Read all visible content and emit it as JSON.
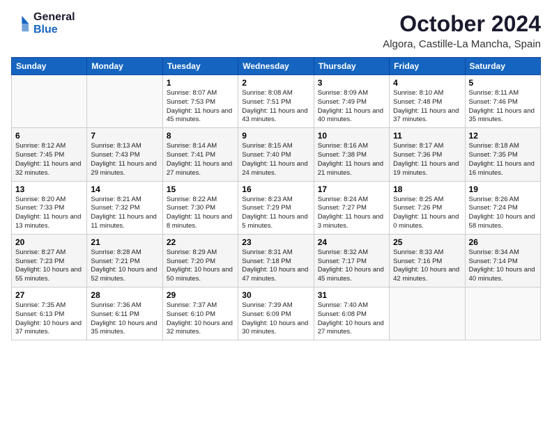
{
  "logo": {
    "general": "General",
    "blue": "Blue"
  },
  "title": "October 2024",
  "subtitle": "Algora, Castille-La Mancha, Spain",
  "days_header": [
    "Sunday",
    "Monday",
    "Tuesday",
    "Wednesday",
    "Thursday",
    "Friday",
    "Saturday"
  ],
  "weeks": [
    [
      {
        "day": "",
        "sunrise": "",
        "sunset": "",
        "daylight": ""
      },
      {
        "day": "",
        "sunrise": "",
        "sunset": "",
        "daylight": ""
      },
      {
        "day": "1",
        "sunrise": "Sunrise: 8:07 AM",
        "sunset": "Sunset: 7:53 PM",
        "daylight": "Daylight: 11 hours and 45 minutes."
      },
      {
        "day": "2",
        "sunrise": "Sunrise: 8:08 AM",
        "sunset": "Sunset: 7:51 PM",
        "daylight": "Daylight: 11 hours and 43 minutes."
      },
      {
        "day": "3",
        "sunrise": "Sunrise: 8:09 AM",
        "sunset": "Sunset: 7:49 PM",
        "daylight": "Daylight: 11 hours and 40 minutes."
      },
      {
        "day": "4",
        "sunrise": "Sunrise: 8:10 AM",
        "sunset": "Sunset: 7:48 PM",
        "daylight": "Daylight: 11 hours and 37 minutes."
      },
      {
        "day": "5",
        "sunrise": "Sunrise: 8:11 AM",
        "sunset": "Sunset: 7:46 PM",
        "daylight": "Daylight: 11 hours and 35 minutes."
      }
    ],
    [
      {
        "day": "6",
        "sunrise": "Sunrise: 8:12 AM",
        "sunset": "Sunset: 7:45 PM",
        "daylight": "Daylight: 11 hours and 32 minutes."
      },
      {
        "day": "7",
        "sunrise": "Sunrise: 8:13 AM",
        "sunset": "Sunset: 7:43 PM",
        "daylight": "Daylight: 11 hours and 29 minutes."
      },
      {
        "day": "8",
        "sunrise": "Sunrise: 8:14 AM",
        "sunset": "Sunset: 7:41 PM",
        "daylight": "Daylight: 11 hours and 27 minutes."
      },
      {
        "day": "9",
        "sunrise": "Sunrise: 8:15 AM",
        "sunset": "Sunset: 7:40 PM",
        "daylight": "Daylight: 11 hours and 24 minutes."
      },
      {
        "day": "10",
        "sunrise": "Sunrise: 8:16 AM",
        "sunset": "Sunset: 7:38 PM",
        "daylight": "Daylight: 11 hours and 21 minutes."
      },
      {
        "day": "11",
        "sunrise": "Sunrise: 8:17 AM",
        "sunset": "Sunset: 7:36 PM",
        "daylight": "Daylight: 11 hours and 19 minutes."
      },
      {
        "day": "12",
        "sunrise": "Sunrise: 8:18 AM",
        "sunset": "Sunset: 7:35 PM",
        "daylight": "Daylight: 11 hours and 16 minutes."
      }
    ],
    [
      {
        "day": "13",
        "sunrise": "Sunrise: 8:20 AM",
        "sunset": "Sunset: 7:33 PM",
        "daylight": "Daylight: 11 hours and 13 minutes."
      },
      {
        "day": "14",
        "sunrise": "Sunrise: 8:21 AM",
        "sunset": "Sunset: 7:32 PM",
        "daylight": "Daylight: 11 hours and 11 minutes."
      },
      {
        "day": "15",
        "sunrise": "Sunrise: 8:22 AM",
        "sunset": "Sunset: 7:30 PM",
        "daylight": "Daylight: 11 hours and 8 minutes."
      },
      {
        "day": "16",
        "sunrise": "Sunrise: 8:23 AM",
        "sunset": "Sunset: 7:29 PM",
        "daylight": "Daylight: 11 hours and 5 minutes."
      },
      {
        "day": "17",
        "sunrise": "Sunrise: 8:24 AM",
        "sunset": "Sunset: 7:27 PM",
        "daylight": "Daylight: 11 hours and 3 minutes."
      },
      {
        "day": "18",
        "sunrise": "Sunrise: 8:25 AM",
        "sunset": "Sunset: 7:26 PM",
        "daylight": "Daylight: 11 hours and 0 minutes."
      },
      {
        "day": "19",
        "sunrise": "Sunrise: 8:26 AM",
        "sunset": "Sunset: 7:24 PM",
        "daylight": "Daylight: 10 hours and 58 minutes."
      }
    ],
    [
      {
        "day": "20",
        "sunrise": "Sunrise: 8:27 AM",
        "sunset": "Sunset: 7:23 PM",
        "daylight": "Daylight: 10 hours and 55 minutes."
      },
      {
        "day": "21",
        "sunrise": "Sunrise: 8:28 AM",
        "sunset": "Sunset: 7:21 PM",
        "daylight": "Daylight: 10 hours and 52 minutes."
      },
      {
        "day": "22",
        "sunrise": "Sunrise: 8:29 AM",
        "sunset": "Sunset: 7:20 PM",
        "daylight": "Daylight: 10 hours and 50 minutes."
      },
      {
        "day": "23",
        "sunrise": "Sunrise: 8:31 AM",
        "sunset": "Sunset: 7:18 PM",
        "daylight": "Daylight: 10 hours and 47 minutes."
      },
      {
        "day": "24",
        "sunrise": "Sunrise: 8:32 AM",
        "sunset": "Sunset: 7:17 PM",
        "daylight": "Daylight: 10 hours and 45 minutes."
      },
      {
        "day": "25",
        "sunrise": "Sunrise: 8:33 AM",
        "sunset": "Sunset: 7:16 PM",
        "daylight": "Daylight: 10 hours and 42 minutes."
      },
      {
        "day": "26",
        "sunrise": "Sunrise: 8:34 AM",
        "sunset": "Sunset: 7:14 PM",
        "daylight": "Daylight: 10 hours and 40 minutes."
      }
    ],
    [
      {
        "day": "27",
        "sunrise": "Sunrise: 7:35 AM",
        "sunset": "Sunset: 6:13 PM",
        "daylight": "Daylight: 10 hours and 37 minutes."
      },
      {
        "day": "28",
        "sunrise": "Sunrise: 7:36 AM",
        "sunset": "Sunset: 6:11 PM",
        "daylight": "Daylight: 10 hours and 35 minutes."
      },
      {
        "day": "29",
        "sunrise": "Sunrise: 7:37 AM",
        "sunset": "Sunset: 6:10 PM",
        "daylight": "Daylight: 10 hours and 32 minutes."
      },
      {
        "day": "30",
        "sunrise": "Sunrise: 7:39 AM",
        "sunset": "Sunset: 6:09 PM",
        "daylight": "Daylight: 10 hours and 30 minutes."
      },
      {
        "day": "31",
        "sunrise": "Sunrise: 7:40 AM",
        "sunset": "Sunset: 6:08 PM",
        "daylight": "Daylight: 10 hours and 27 minutes."
      },
      {
        "day": "",
        "sunrise": "",
        "sunset": "",
        "daylight": ""
      },
      {
        "day": "",
        "sunrise": "",
        "sunset": "",
        "daylight": ""
      }
    ]
  ]
}
